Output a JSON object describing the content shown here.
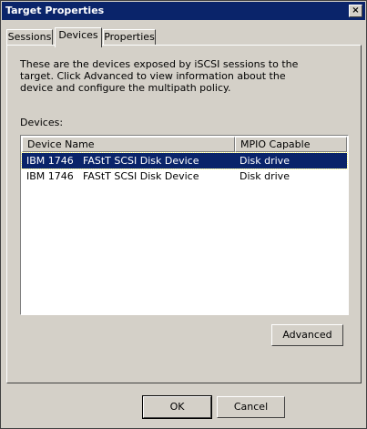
{
  "window": {
    "title": "Target Properties",
    "close_glyph": "×"
  },
  "tabs": [
    {
      "label": "Sessions"
    },
    {
      "label": "Devices",
      "active": true
    },
    {
      "label": "Properties"
    }
  ],
  "devices": {
    "description": "These are the devices exposed by iSCSI sessions to the target. Click Advanced to view information about the device and configure the multipath policy.",
    "list_label": "Devices:",
    "columns": [
      "Device Name",
      "MPIO Capable"
    ],
    "rows": [
      {
        "vendor": "IBM 1746",
        "name": "FAStT SCSI Disk Device",
        "mpio": "Disk drive",
        "selected": true
      },
      {
        "vendor": "IBM 1746",
        "name": "FAStT SCSI Disk Device",
        "mpio": "Disk drive",
        "selected": false
      }
    ],
    "advanced_label": "Advanced"
  },
  "footer": {
    "ok_label": "OK",
    "cancel_label": "Cancel"
  }
}
